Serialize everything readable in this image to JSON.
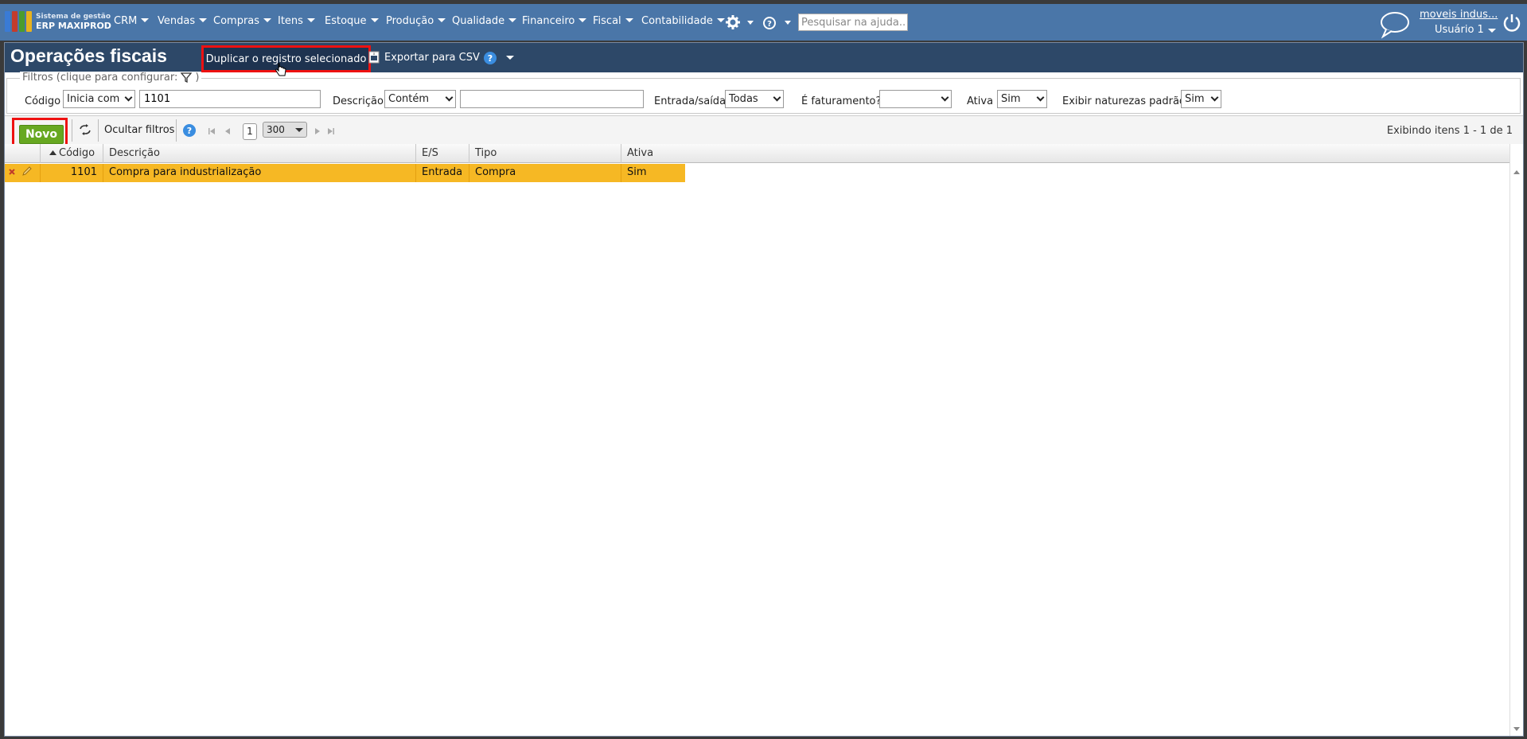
{
  "app": {
    "logo_line1": "Sistema de gestão",
    "logo_line2": "ERP MAXIPROD",
    "logo_colors": [
      "#3a7bd5",
      "#c43b2b",
      "#4a9c2e",
      "#e8b21e"
    ]
  },
  "nav": {
    "menus": [
      "CRM",
      "Vendas",
      "Compras",
      "Itens",
      "Estoque",
      "Produção",
      "Qualidade",
      "Financeiro",
      "Fiscal",
      "Contabilidade"
    ],
    "help_search_placeholder": "Pesquisar na ajuda...",
    "company": "moveis indus...",
    "user": "Usuário 1",
    "icons": [
      "gear-icon",
      "help-circle-icon",
      "chat-icon",
      "power-icon"
    ]
  },
  "page": {
    "title": "Operações fiscais",
    "duplicate_label": "Duplicar o registro selecionado",
    "export_label": "Exportar para CSV"
  },
  "filters": {
    "legend": "Filtros (clique para configurar:",
    "legend_close": ")",
    "codigo_label": "Código",
    "codigo_operator": "Inicia com",
    "codigo_value": "1101",
    "descricao_label": "Descrição",
    "descricao_operator": "Contém",
    "descricao_value": "",
    "es_label": "Entrada/saída",
    "es_value": "Todas",
    "faturamento_label": "É faturamento?",
    "faturamento_value": "",
    "ativa_label": "Ativa",
    "ativa_value": "Sim",
    "naturezas_label": "Exibir naturezas padrão",
    "naturezas_value": "Sim"
  },
  "toolbar": {
    "new_label": "Novo",
    "hide_filters_label": "Ocultar filtros",
    "page_number": "1",
    "page_size": "300",
    "items_info": "Exibindo itens 1 - 1 de 1"
  },
  "grid": {
    "columns": [
      "Código",
      "Descrição",
      "E/S",
      "Tipo",
      "Ativa"
    ],
    "sort_column": "Código",
    "rows": [
      {
        "codigo": "1101",
        "descricao": "Compra para industrialização",
        "es": "Entrada",
        "tipo": "Compra",
        "ativa": "Sim"
      }
    ],
    "selected_row_color": "#f6b824"
  },
  "colors": {
    "nav_bg": "#4a76a8",
    "title_bg": "#2d4868",
    "new_button": "#67a821",
    "highlight": "#e11111"
  }
}
